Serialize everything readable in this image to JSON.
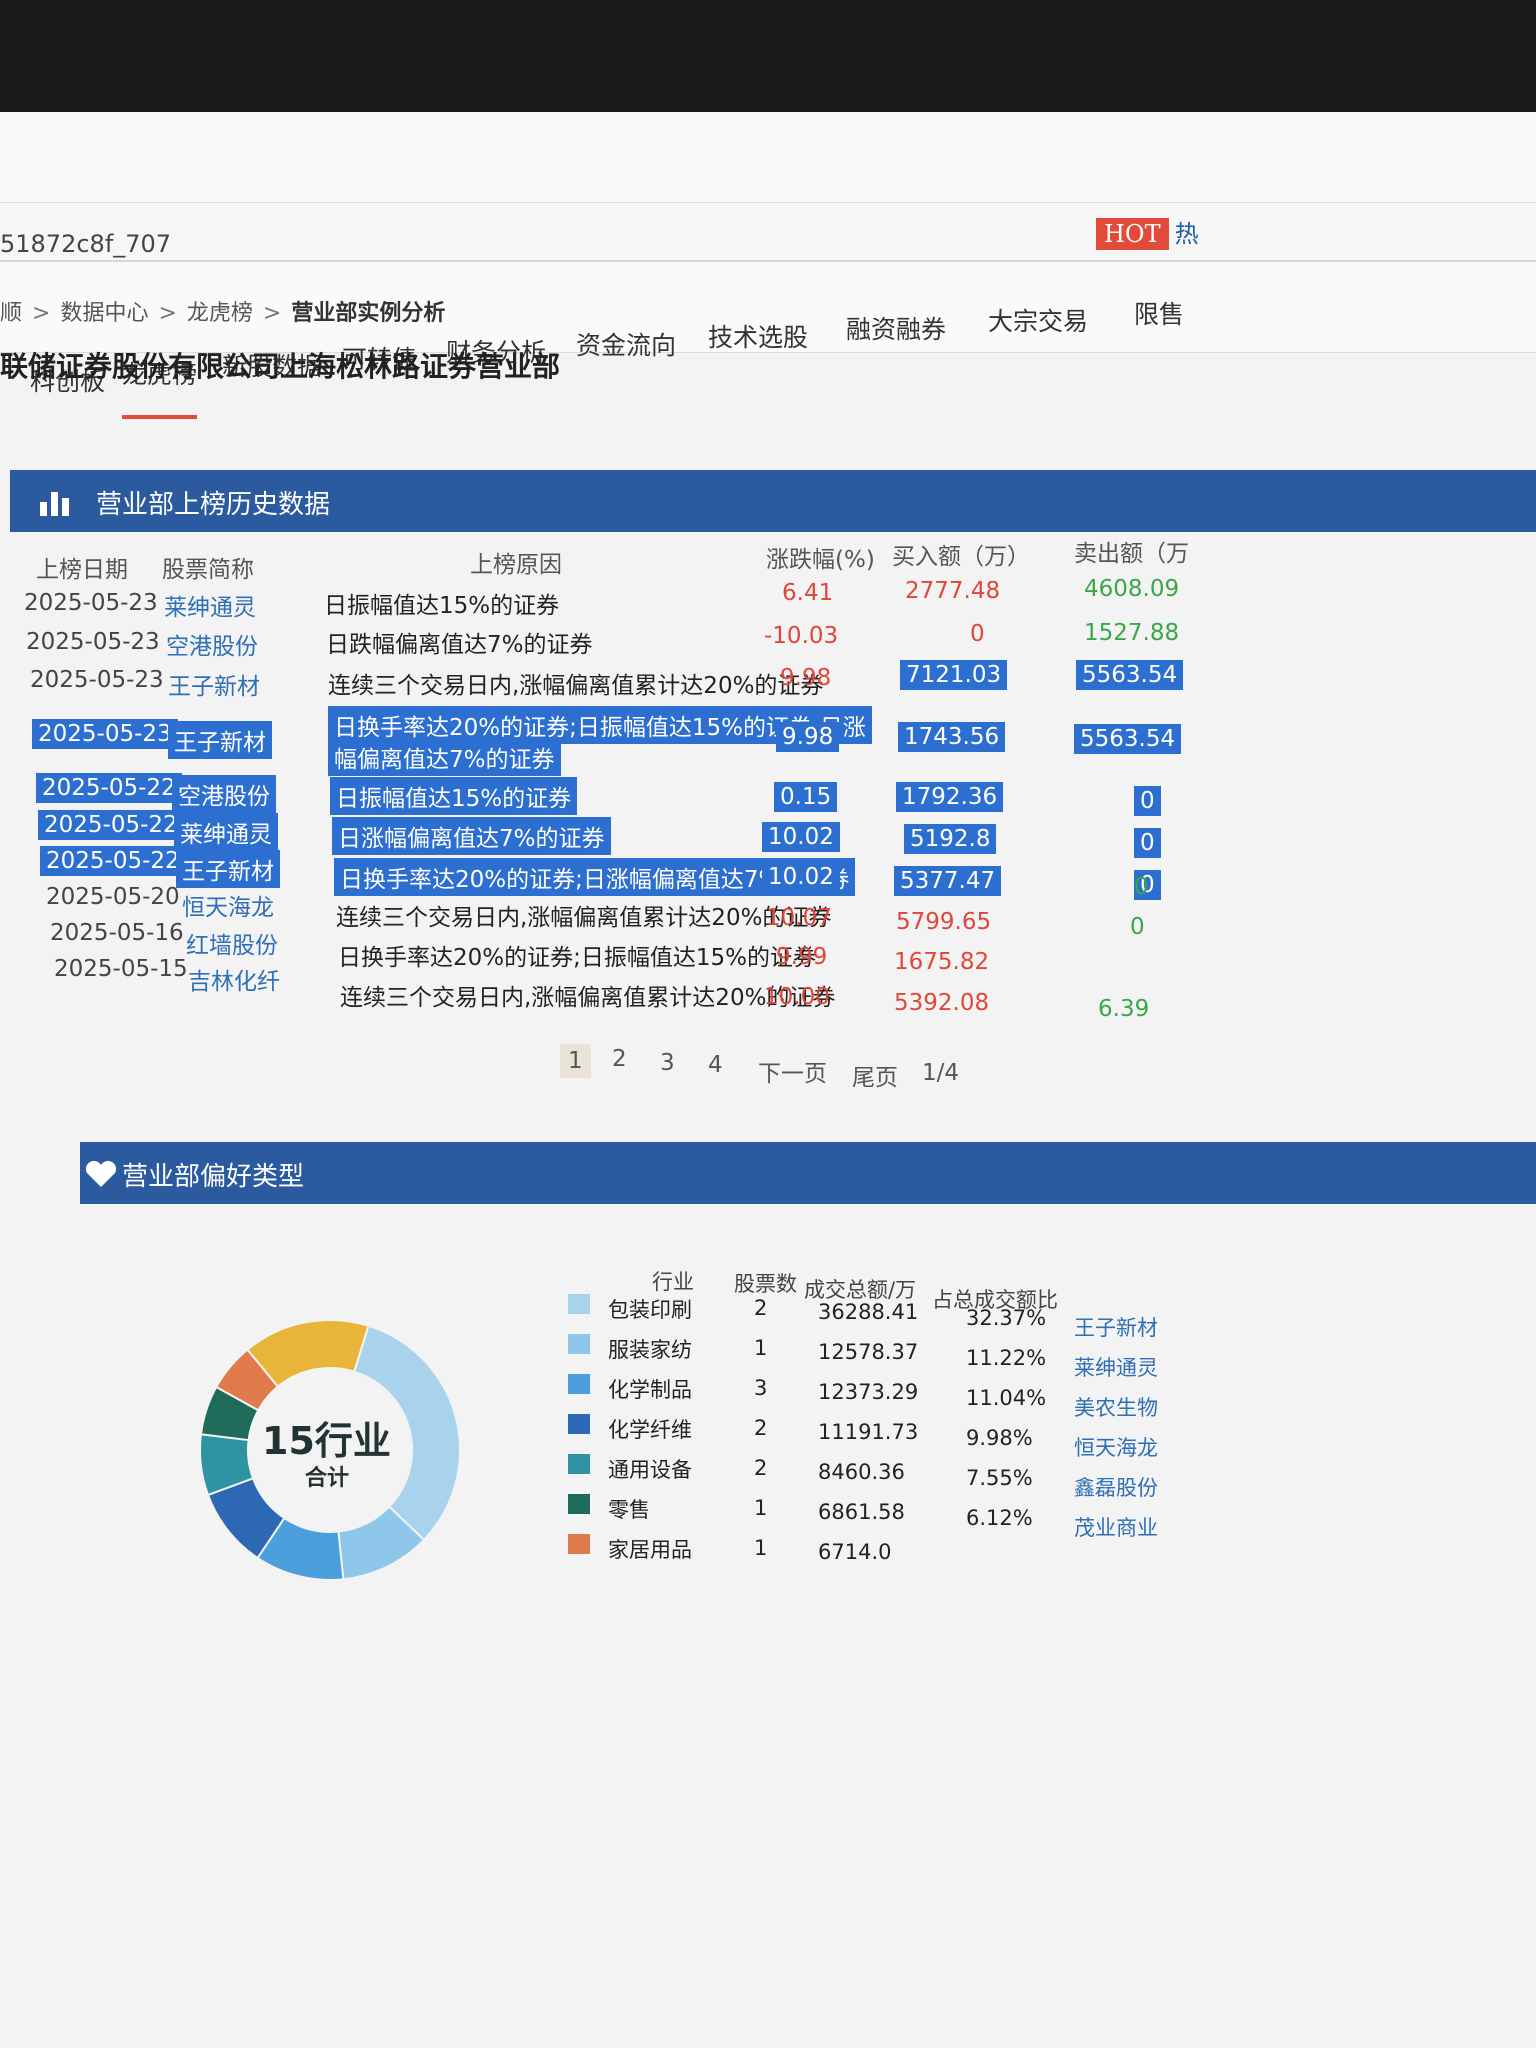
{
  "url": "51872c8f_707",
  "nav": [
    "科创板",
    "龙虎榜",
    "新股数据",
    "可转债",
    "财务分析",
    "资金流向",
    "技术选股",
    "融资融券",
    "大宗交易",
    "限售"
  ],
  "hot": {
    "badge": "HOT",
    "text": "热"
  },
  "breadcrumb": [
    "顺",
    "数据中心",
    "龙虎榜",
    "营业部实例分析"
  ],
  "branch_name": "联储证券股份有限公司上海松林路证券营业部",
  "history": {
    "title": "营业部上榜历史数据",
    "headers": [
      "上榜日期",
      "股票简称",
      "上榜原因",
      "涨跌幅(%)",
      "买入额（万）",
      "卖出额（万"
    ],
    "rows": [
      {
        "date": "2025-05-23",
        "stock": "莱绅通灵",
        "reason": "日振幅值达15%的证券",
        "change": "6.41",
        "buy": "2777.48",
        "sell": "4608.09"
      },
      {
        "date": "2025-05-23",
        "stock": "空港股份",
        "reason": "日跌幅偏离值达7%的证券",
        "change": "-10.03",
        "buy": "0",
        "sell": "1527.88"
      },
      {
        "date": "2025-05-23",
        "stock": "王子新材",
        "reason": "连续三个交易日内,涨幅偏离值累计达20%的证券",
        "change": "9.98",
        "buy": "7121.03",
        "sell": "5563.54"
      },
      {
        "date": "2025-05-23",
        "stock": "王子新材",
        "reason": "日换手率达20%的证券;日振幅值达15%的证券;日涨",
        "reason2": "幅偏离值达7%的证券",
        "change": "9.98",
        "buy": "1743.56",
        "sell": "5563.54"
      },
      {
        "date": "2025-05-22",
        "stock": "空港股份",
        "reason": "日振幅值达15%的证券",
        "change": "0.15",
        "buy": "1792.36",
        "sell": "0"
      },
      {
        "date": "2025-05-22",
        "stock": "莱绅通灵",
        "reason": "日涨幅偏离值达7%的证券",
        "change": "10.02",
        "buy": "5192.8",
        "sell": "0"
      },
      {
        "date": "2025-05-22",
        "stock": "王子新材",
        "reason": "日换手率达20%的证券;日涨幅偏离值达7%的证券",
        "change": "10.02",
        "buy": "5377.47",
        "sell": "0"
      },
      {
        "date": "2025-05-20",
        "stock": "恒天海龙",
        "reason": "连续三个交易日内,涨幅偏离值累计达20%的证券",
        "change": "10.07",
        "buy": "5799.65",
        "sell": "0"
      },
      {
        "date": "2025-05-16",
        "stock": "红墙股份",
        "reason": "日换手率达20%的证券;日振幅值达15%的证券",
        "change": "9.99",
        "buy": "1675.82",
        "sell": "0"
      },
      {
        "date": "2025-05-15",
        "stock": "吉林化纤",
        "reason": "连续三个交易日内,涨幅偏离值累计达20%的证券",
        "change": "10.00",
        "buy": "5392.08",
        "sell": "6.39"
      }
    ],
    "pager": [
      "1",
      "2",
      "3",
      "4",
      "下一页",
      "尾页",
      "1/4"
    ]
  },
  "preference": {
    "title": "营业部偏好类型",
    "donut_label": "15行业",
    "donut_sub": "合计",
    "headers": [
      "行业",
      "股票数",
      "成交总额/万",
      "占总成交额比"
    ],
    "rows": [
      {
        "industry": "包装印刷",
        "count": "2",
        "amount": "36288.41",
        "pct": "32.37%",
        "stock": "王子新材",
        "color": "#a9d3ec"
      },
      {
        "industry": "服装家纺",
        "count": "1",
        "amount": "12578.37",
        "pct": "11.22%",
        "stock": "莱绅通灵",
        "color": "#8fc7ea"
      },
      {
        "industry": "化学制品",
        "count": "3",
        "amount": "12373.29",
        "pct": "11.04%",
        "stock": "美农生物",
        "color": "#4a9fdc"
      },
      {
        "industry": "化学纤维",
        "count": "2",
        "amount": "11191.73",
        "pct": "9.98%",
        "stock": "恒天海龙",
        "color": "#2c68b4"
      },
      {
        "industry": "通用设备",
        "count": "2",
        "amount": "8460.36",
        "pct": "7.55%",
        "stock": "鑫磊股份",
        "color": "#2e93a2"
      },
      {
        "industry": "零售",
        "count": "1",
        "amount": "6861.58",
        "pct": "6.12%",
        "stock": "茂业商业",
        "color": "#1f6b5a"
      },
      {
        "industry": "家居用品",
        "count": "1",
        "amount": "6714.0",
        "pct": "",
        "stock": "",
        "color": "#e07a4a"
      }
    ]
  }
}
